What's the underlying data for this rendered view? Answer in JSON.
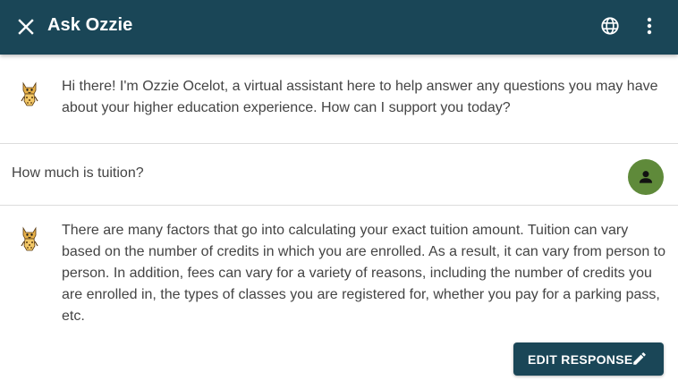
{
  "header": {
    "title": "Ask Ozzie",
    "close_icon": "close-icon",
    "globe_icon": "globe-icon",
    "menu_icon": "more-vert-icon",
    "background": "#1a4657"
  },
  "conversation": {
    "bot_greeting": "Hi there! I'm Ozzie Ocelot, a virtual assistant here to help answer any questions you may have about your higher education experience. How can I support you today?",
    "user_question": "How much is tuition?",
    "bot_answer": "There are many factors that go into calculating your exact tuition amount. Tuition can vary based on the number of credits in which you are enrolled. As a result, it can vary from person to person. In addition, fees can vary for a variety of reasons, including the number of credits you are enrolled in, the types of classes you are registered for, whether you pay for a parking pass, etc.",
    "bot_avatar_icon": "ocelot-mascot-icon",
    "user_avatar_icon": "person-icon",
    "user_avatar_color": "#5f8a3a"
  },
  "actions": {
    "edit_response_label": "EDIT RESPONSE",
    "edit_icon": "pencil-icon"
  }
}
